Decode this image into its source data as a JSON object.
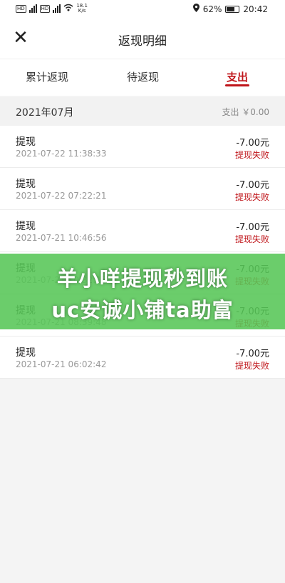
{
  "status_bar": {
    "network_speed": "18.1",
    "network_unit": "K/s",
    "battery": "62%",
    "time": "20:42"
  },
  "header": {
    "close_icon": "close-icon",
    "title": "返现明细"
  },
  "tabs": [
    {
      "label": "累计返现",
      "active": false
    },
    {
      "label": "待返现",
      "active": false
    },
    {
      "label": "支出",
      "active": true
    }
  ],
  "month_group": {
    "month": "2021年07月",
    "total": "支出 ￥0.00"
  },
  "records": [
    {
      "title": "提现",
      "time": "2021-07-22 11:38:33",
      "amount": "-7.00元",
      "status": "提现失败"
    },
    {
      "title": "提现",
      "time": "2021-07-22 07:22:21",
      "amount": "-7.00元",
      "status": "提现失败"
    },
    {
      "title": "提现",
      "time": "2021-07-21 10:46:56",
      "amount": "-7.00元",
      "status": "提现失败"
    },
    {
      "title": "提现",
      "time": "2021-07-21 10:32:15",
      "amount": "-7.00元",
      "status": "提现失败"
    },
    {
      "title": "提现",
      "time": "2021-07-21 08:39:48",
      "amount": "-7.00元",
      "status": "提现失败"
    },
    {
      "title": "提现",
      "time": "2021-07-21 06:02:42",
      "amount": "-7.00元",
      "status": "提现失败"
    }
  ],
  "overlay_banner": {
    "line1": "羊小咩提现秒到账",
    "line2": "uc安诚小铺ta助富"
  },
  "colors": {
    "accent": "#c0161b",
    "banner": "#56c656"
  }
}
